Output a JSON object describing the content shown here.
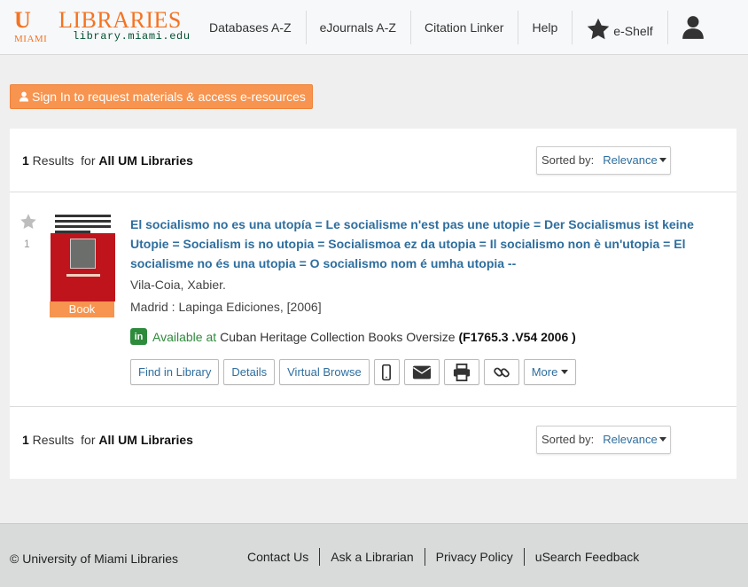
{
  "header": {
    "logo": {
      "u": "U",
      "miami": "MIAMI",
      "libraries": "LIBRARIES",
      "url": "library.miami.edu"
    },
    "nav": [
      {
        "label": "Databases A-Z"
      },
      {
        "label": "eJournals A-Z"
      },
      {
        "label": "Citation Linker"
      },
      {
        "label": "Help"
      },
      {
        "label": "e-Shelf",
        "icon": "star-icon"
      },
      {
        "label": "",
        "icon": "user-icon"
      }
    ]
  },
  "signin": {
    "label": "Sign In to request materials & access e-resources",
    "icon": "user-icon"
  },
  "results": {
    "count": "1",
    "results_word": " Results  for ",
    "scope": "All UM Libraries",
    "sort_label": "Sorted by:",
    "sort_value": "Relevance"
  },
  "record": {
    "number": "1",
    "type": "Book",
    "title": "El socialismo no es una utopía = Le socialisme n'est pas une utopie = Der Socialismus ist keine Utopie = Socialism is no utopia = Socialismoa ez da utopia = Il socialismo non è un'utopia = El socialisme no és una utopia = O socialismo nom é umha utopia --",
    "author": "Vila-Coia, Xabier.",
    "publication": "Madrid : Lapinga Ediciones, [2006]",
    "availability": {
      "badge": "in",
      "status": "Available at",
      "location": "Cuban Heritage Collection Books Oversize",
      "call_number": "(F1765.3 .V54 2006 )"
    },
    "actions": {
      "find": "Find in Library",
      "details": "Details",
      "browse": "Virtual Browse",
      "more": "More"
    }
  },
  "colors": {
    "accent_orange": "#f7944f",
    "link_blue": "#2e6e9e",
    "available_green": "#2e8b3c",
    "um_green": "#005030"
  },
  "footer": {
    "copyright": "© University of Miami Libraries",
    "links": [
      "Contact Us",
      "Ask a Librarian",
      "Privacy Policy",
      "uSearch Feedback"
    ]
  }
}
